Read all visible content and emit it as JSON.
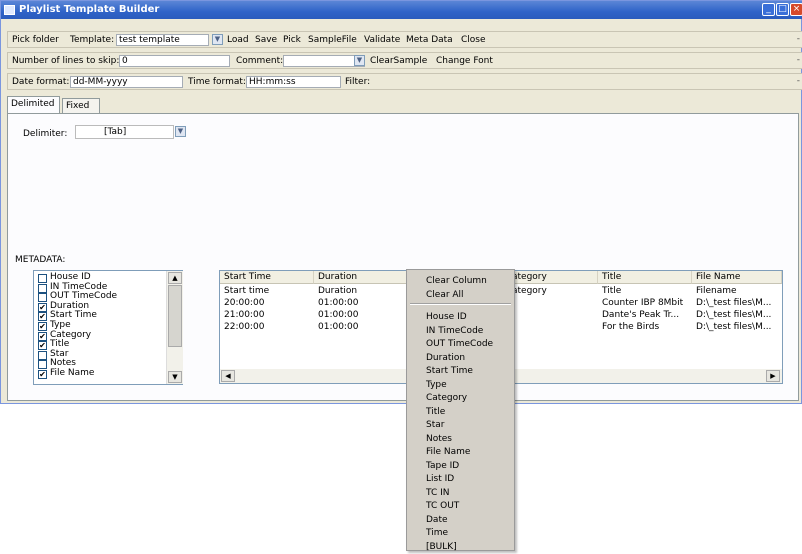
{
  "window": {
    "title": "Playlist Template Builder"
  },
  "toolbar1": {
    "pick_folder": "Pick folder",
    "template_label": "Template:",
    "template_value": "test template",
    "menu": [
      "Load",
      "Save",
      "Pick",
      "SampleFile",
      "Validate",
      "Meta Data",
      "Close"
    ]
  },
  "toolbar2": {
    "skip_label": "Number of lines to skip:",
    "skip_value": "0",
    "comment_label": "Comment:",
    "comment_value": "",
    "clear_sample": "ClearSample",
    "change_font": "Change Font"
  },
  "toolbar3": {
    "date_label": "Date format:",
    "date_value": "dd-MM-yyyy",
    "time_label": "Time format:",
    "time_value": "HH:mm:ss",
    "filter_label": "Filter:",
    "filter_value": ""
  },
  "tabs": [
    "Delimited",
    "Fixed"
  ],
  "delimiter": {
    "label": "Delimiter:",
    "value": "[Tab]"
  },
  "metadata": {
    "label": "METADATA:",
    "items": [
      {
        "label": "House ID",
        "checked": false
      },
      {
        "label": "IN TimeCode",
        "checked": false
      },
      {
        "label": "OUT TimeCode",
        "checked": false
      },
      {
        "label": "Duration",
        "checked": true
      },
      {
        "label": "Start Time",
        "checked": true
      },
      {
        "label": "Type",
        "checked": true
      },
      {
        "label": "Category",
        "checked": true
      },
      {
        "label": "Title",
        "checked": true
      },
      {
        "label": "Star",
        "checked": false
      },
      {
        "label": "Notes",
        "checked": false
      },
      {
        "label": "File Name",
        "checked": true
      }
    ]
  },
  "grid": {
    "headers": [
      "Start Time",
      "Duration",
      "",
      "ategory",
      "Title",
      "File Name"
    ],
    "rows": [
      [
        "Start time",
        "Duration",
        "",
        "ategory",
        "Title",
        "Filename"
      ],
      [
        "20:00:00",
        "01:00:00",
        "",
        "",
        "Counter IBP 8Mbit",
        "D:\\_test files\\M..."
      ],
      [
        "21:00:00",
        "01:00:00",
        "",
        "",
        "Dante's Peak Tr...",
        "D:\\_test files\\M..."
      ],
      [
        "22:00:00",
        "01:00:00",
        "",
        "",
        "For the Birds",
        "D:\\_test files\\M..."
      ]
    ]
  },
  "context_menu": {
    "top_items": [
      "Clear Column",
      "Clear All"
    ],
    "items": [
      "House ID",
      "IN TimeCode",
      "OUT TimeCode",
      "Duration",
      "Start Time",
      "Type",
      "Category",
      "Title",
      "Star",
      "Notes",
      "File Name",
      "Tape ID",
      "List ID",
      "TC IN",
      "TC OUT",
      "Date",
      "Time",
      "[BULK]"
    ]
  },
  "icons": {
    "dropdown": "chevron-down-icon",
    "scroll_up": "scroll-up-arrow-icon",
    "scroll_down": "scroll-down-arrow-icon",
    "scroll_left": "scroll-left-arrow-icon",
    "scroll_right": "scroll-right-arrow-icon"
  },
  "colors": {
    "titlebar": "#2f63c8",
    "window_bg": "#ece9d8",
    "menu_bg": "#d4d0c8"
  }
}
